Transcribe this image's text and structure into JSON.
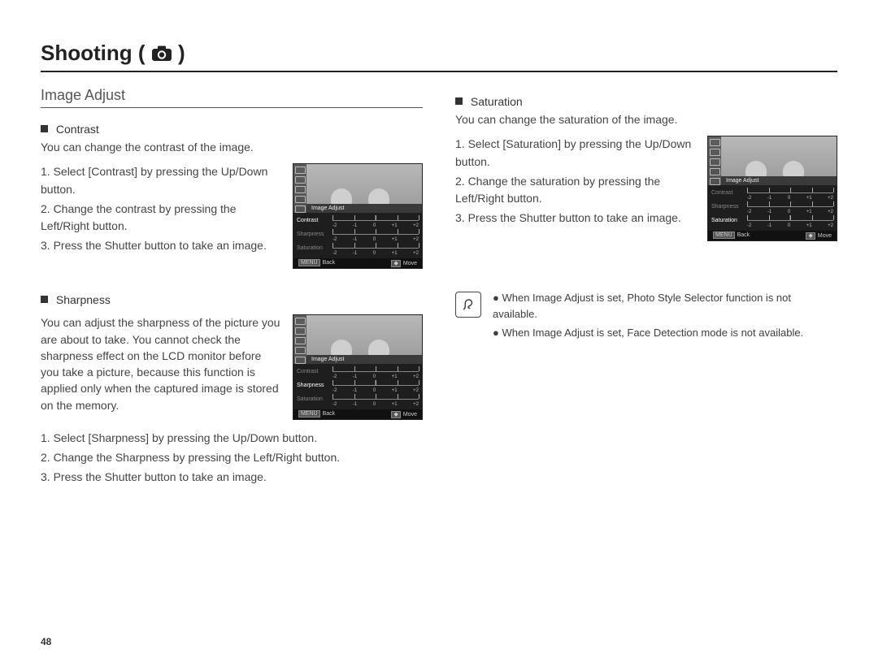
{
  "page": {
    "number": "48",
    "title_text": "Shooting (",
    "title_suffix": ")"
  },
  "section": {
    "title": "Image Adjust"
  },
  "contrast": {
    "heading": "Contrast",
    "desc": "You can change the contrast of the image.",
    "step1": "1. Select [Contrast] by pressing the Up/Down button.",
    "step2": "2. Change the contrast by pressing the Left/Right button.",
    "step3": "3. Press the Shutter button to take an image."
  },
  "sharpness": {
    "heading": "Sharpness",
    "desc": "You can adjust the sharpness of the picture you are about to take. You cannot check the sharpness effect on the LCD monitor before you take a picture, because this function is applied only when the captured image is stored on the memory.",
    "step1": "1. Select [Sharpness] by pressing the Up/Down button.",
    "step2": "2. Change the Sharpness by pressing the Left/Right button.",
    "step3": "3. Press the Shutter button to take an image."
  },
  "saturation": {
    "heading": "Saturation",
    "desc": "You can change the saturation of the image.",
    "step1": "1. Select [Saturation] by pressing the Up/Down button.",
    "step2": "2. Change the saturation by pressing the Left/Right button.",
    "step3": "3. Press the Shutter button to take an image."
  },
  "notes": {
    "bullet": "●",
    "n1": "When Image Adjust  is set, Photo Style Selector function is not available.",
    "n2": "When Image Adjust is set, Face Detection mode is not available."
  },
  "lcd": {
    "title": "Image Adjust",
    "contrast": "Contrast",
    "sharpness": "Sharpness",
    "saturation": "Saturation",
    "back": "Back",
    "move": "Move",
    "backbtn": "MENU",
    "movebtn": "◆",
    "t_m2": "-2",
    "t_m1": "-1",
    "t_0": "0",
    "t_p1": "+1",
    "t_p2": "+2"
  }
}
